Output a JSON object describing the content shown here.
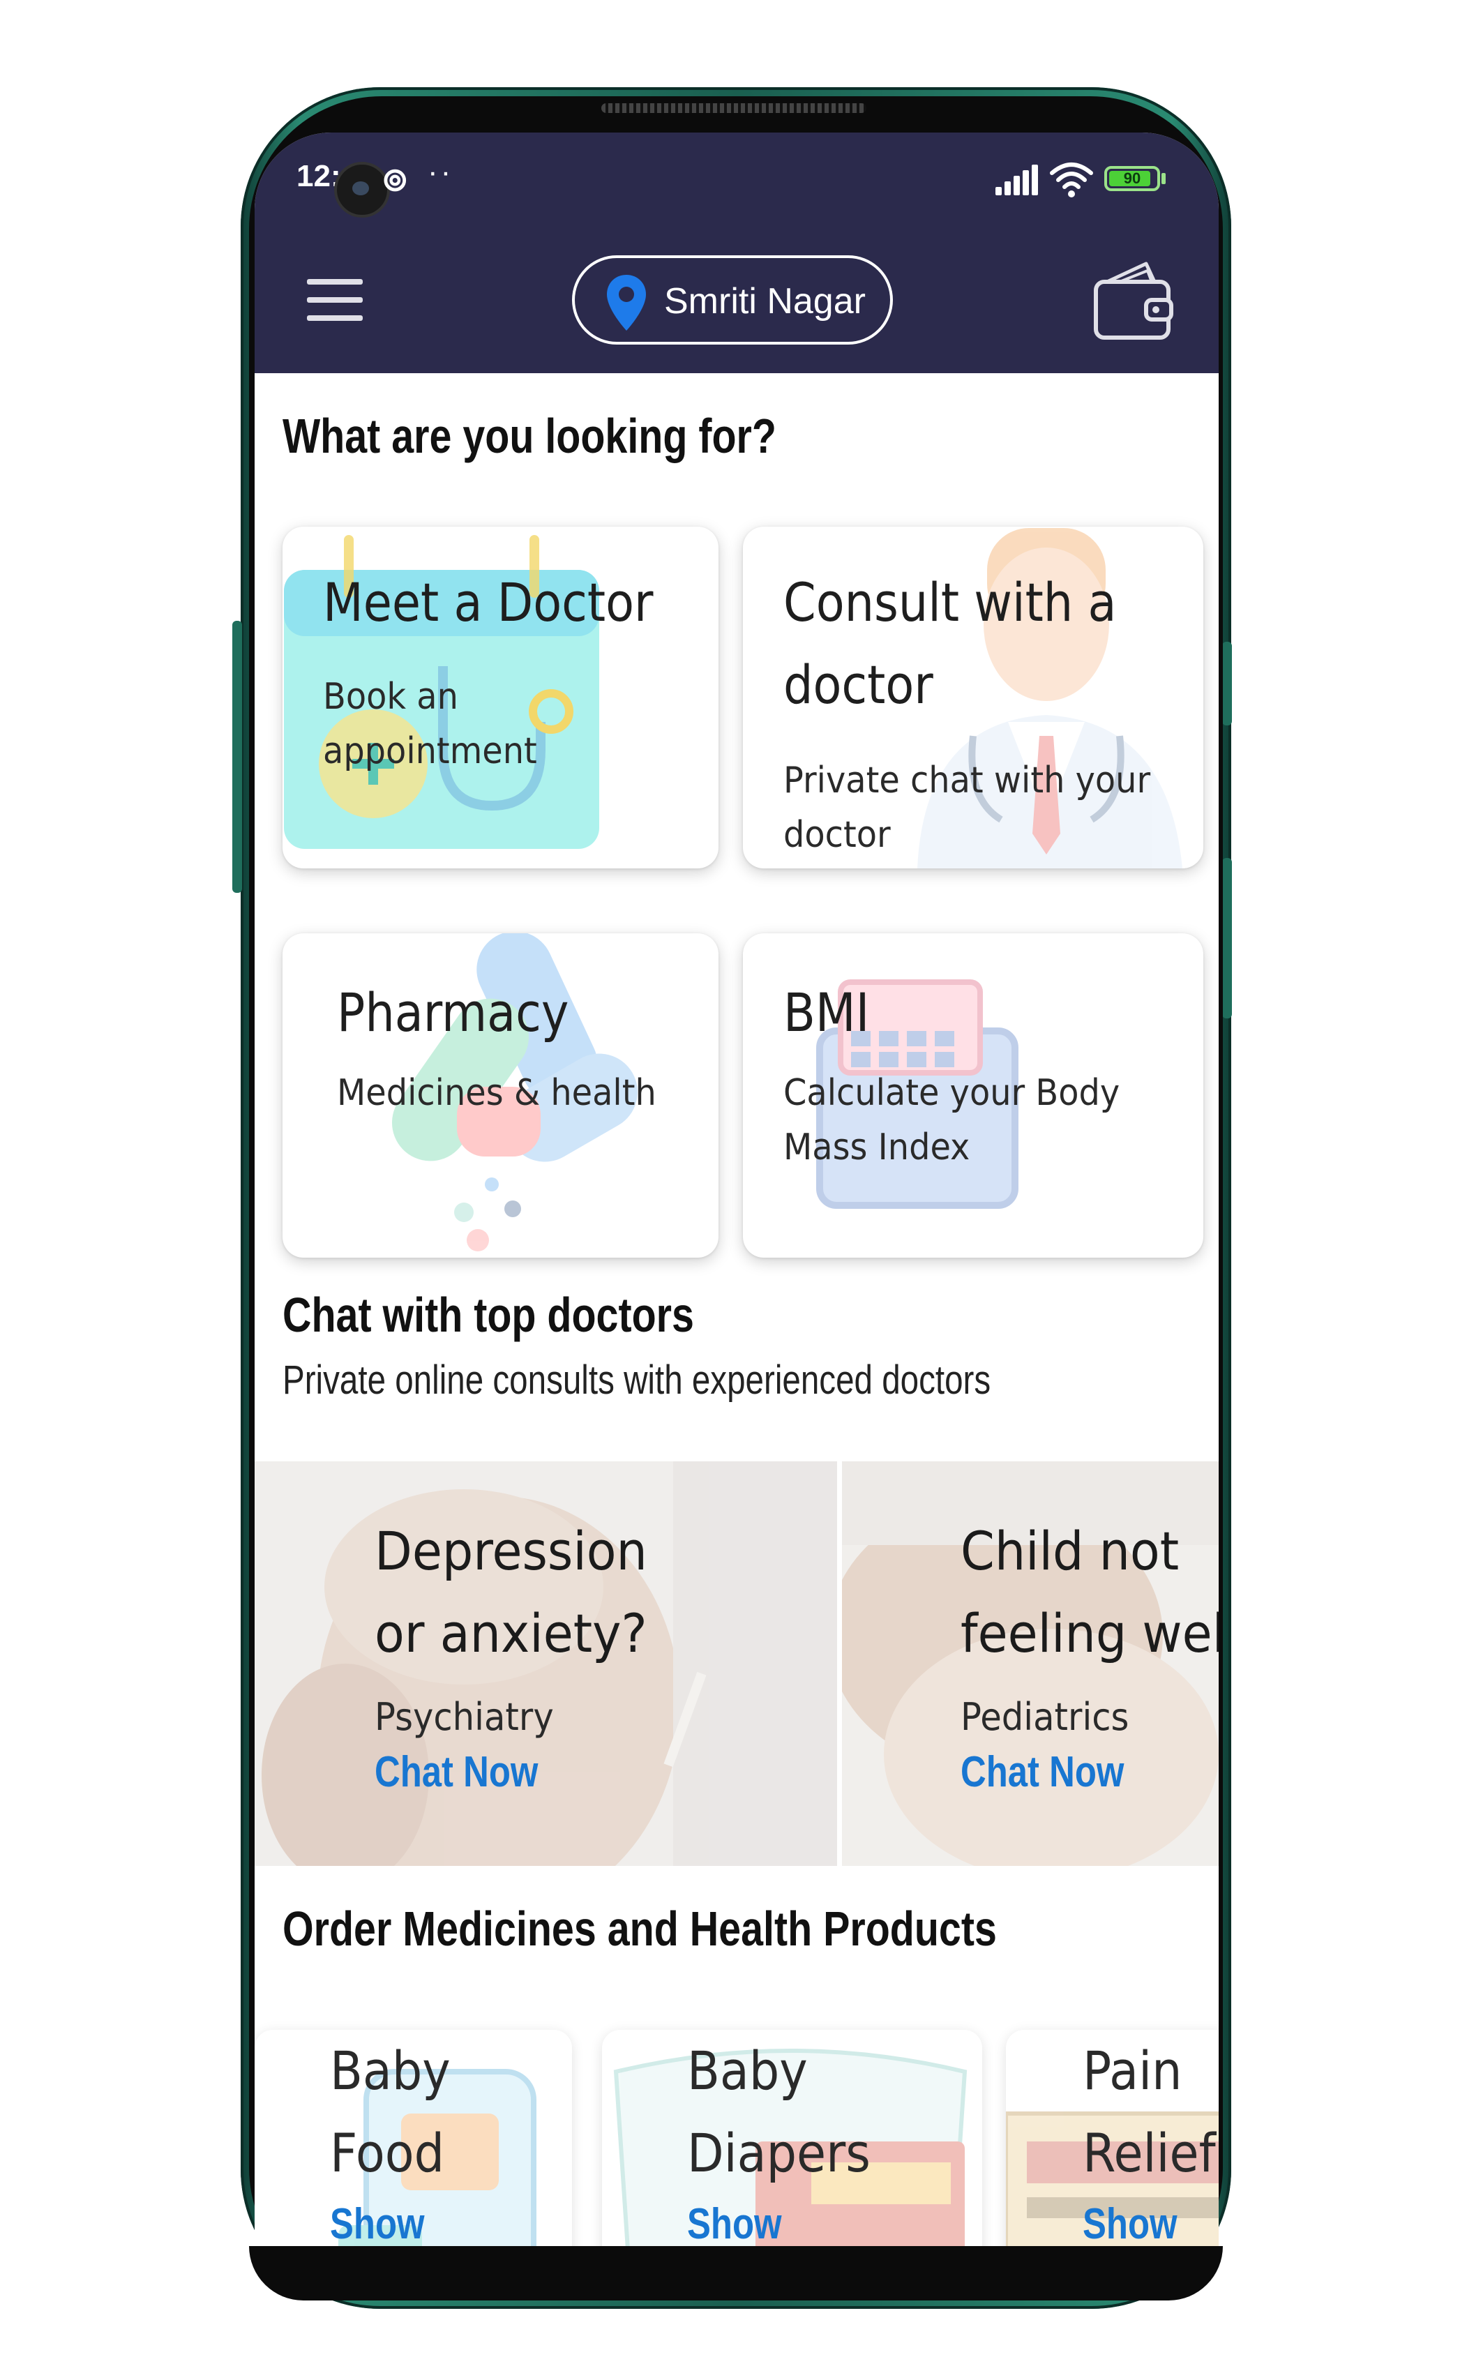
{
  "status_bar": {
    "time": "12:",
    "battery": "90",
    "battery_level": 0.9
  },
  "app_bar": {
    "location": "Smriti Nagar",
    "menu_icon": "hamburger-menu-icon",
    "location_icon": "map-pin-icon",
    "wallet_icon": "wallet-icon"
  },
  "looking_for": {
    "title": "What are you looking for?",
    "cards": [
      {
        "title": "Meet a Doctor",
        "desc": "Book an appointment"
      },
      {
        "title": "Consult with a doctor",
        "desc": "Private chat with your doctor"
      },
      {
        "title": "Pharmacy",
        "desc": "Medicines & health"
      },
      {
        "title": "BMI",
        "desc": "Calculate your Body Mass Index"
      }
    ]
  },
  "chat": {
    "title": "Chat with top doctors",
    "subtitle": "Private online consults with experienced doctors",
    "tiles": [
      {
        "title": "Depression or anxiety?",
        "specialty": "Psychiatry",
        "action": "Chat Now"
      },
      {
        "title": "Child not feeling well?",
        "specialty": "Pediatrics",
        "action": "Chat Now"
      }
    ]
  },
  "products": {
    "title": "Order Medicines and Health Products",
    "items": [
      {
        "title": "Baby Food",
        "action": "Show"
      },
      {
        "title": "Baby Diapers",
        "action": "Show"
      },
      {
        "title": "Pain Relief",
        "action": "Show"
      }
    ]
  },
  "colors": {
    "app_bar": "#2b2a4c",
    "link": "#1876d1",
    "phone_frame": "#1f6e5c"
  }
}
